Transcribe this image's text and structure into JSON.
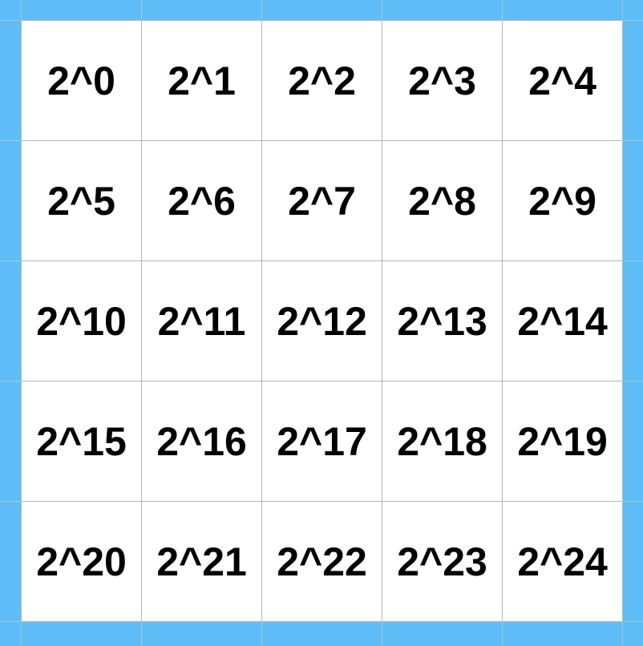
{
  "colors": {
    "frame": "#5fbef7",
    "cell_background": "#ffffff",
    "grid_line": "#b5b5b5",
    "text": "#000000"
  },
  "grid": {
    "rows": [
      [
        "2^0",
        "2^1",
        "2^2",
        "2^3",
        "2^4"
      ],
      [
        "2^5",
        "2^6",
        "2^7",
        "2^8",
        "2^9"
      ],
      [
        "2^10",
        "2^11",
        "2^12",
        "2^13",
        "2^14"
      ],
      [
        "2^15",
        "2^16",
        "2^17",
        "2^18",
        "2^19"
      ],
      [
        "2^20",
        "2^21",
        "2^22",
        "2^23",
        "2^24"
      ]
    ]
  }
}
